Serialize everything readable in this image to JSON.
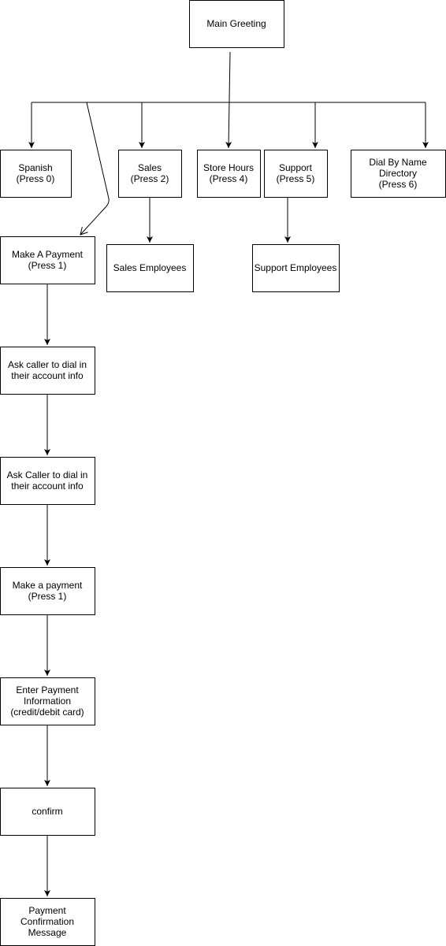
{
  "nodes": {
    "main_greeting": [
      "Main Greeting"
    ],
    "spanish": [
      "Spanish",
      "(Press 0)"
    ],
    "sales": [
      "Sales",
      "(Press 2)"
    ],
    "store_hours": [
      "Store Hours",
      "(Press 4)"
    ],
    "support": [
      "Support",
      "(Press 5)"
    ],
    "dial_by_name": [
      "Dial By Name",
      "Directory",
      "(Press 6)"
    ],
    "make_a_payment": [
      "Make A Payment",
      "(Press 1)"
    ],
    "sales_employees": [
      "Sales Employees"
    ],
    "support_employees": [
      "Support Employees"
    ],
    "ask_caller_1": [
      "Ask caller to dial in",
      "their account info"
    ],
    "ask_caller_2": [
      "Ask Caller to dial in",
      "their account info"
    ],
    "make_payment_2": [
      "Make a payment",
      "(Press 1)"
    ],
    "enter_payment": [
      "Enter Payment",
      "Information",
      "(credit/debit card)"
    ],
    "confirm": [
      "confirm"
    ],
    "payment_confirmation": [
      "Payment",
      "Confirmation",
      "Message"
    ]
  }
}
